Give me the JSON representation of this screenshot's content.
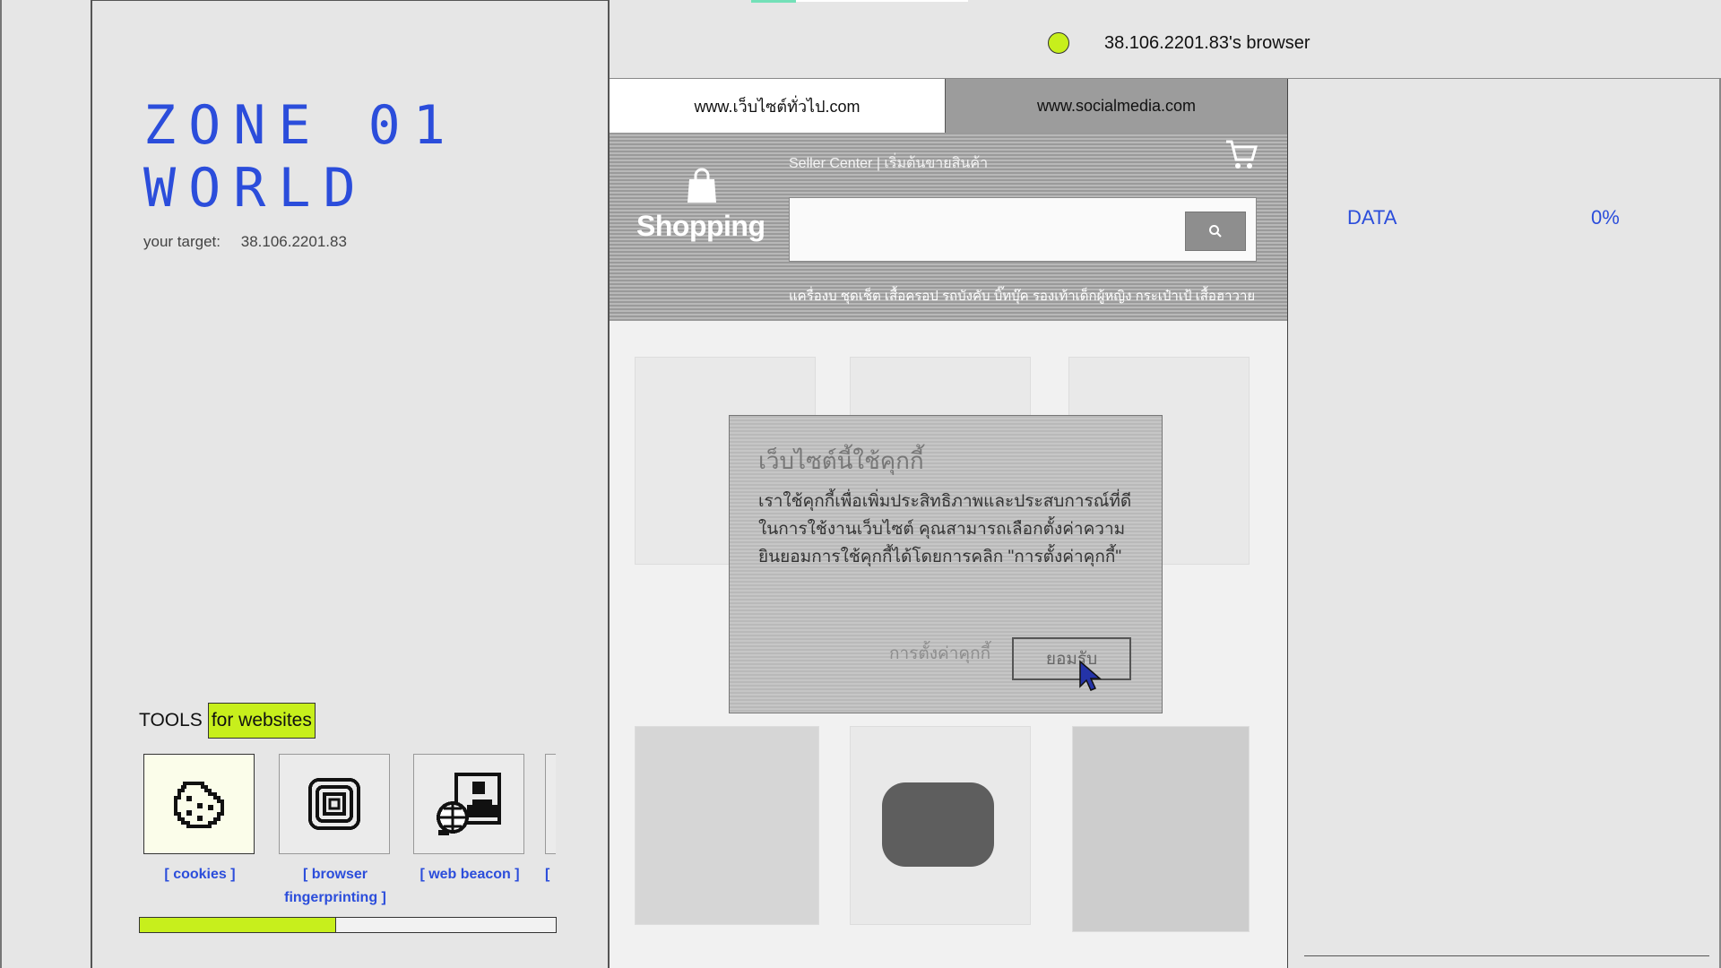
{
  "zone": {
    "title_line1": "ZONE 01",
    "title_line2": "WORLD"
  },
  "target": {
    "label": "your target:",
    "value": "38.106.2201.83"
  },
  "tools": {
    "label": "TOOLS",
    "pill": "for websites",
    "items": [
      {
        "label": "[ cookies ]",
        "icon": "cookie-icon",
        "active": true
      },
      {
        "label": "[ browser fingerprinting ]",
        "icon": "fingerprint-icon",
        "active": false
      },
      {
        "label": "[ web beacon ]",
        "icon": "web-beacon-icon",
        "active": false
      },
      {
        "label": "[",
        "icon": "",
        "active": false
      }
    ],
    "progress": 0.47
  },
  "browser": {
    "title": "38.106.2201.83's browser",
    "status_color": "#c7ef1c",
    "tabs": [
      {
        "label": "www.เว็บไซต์ทั่วไป.com",
        "active": true
      },
      {
        "label": "www.socialmedia.com",
        "active": false
      }
    ]
  },
  "site": {
    "seller_link": "Seller Center  |  เริ่มต้นขายสินค้า",
    "brand": "Shopping",
    "categories": "แครื่องบ ชุดเช็ต เสื้อครอป รถบังคับ บิ๊ทบุ๊ค รองเท้าเด็กผู้หญิง กระเป๋าเป้ เสื้อฮาวาย"
  },
  "cookie_modal": {
    "title": "เว็บไซต์นี้ใช้คุกกี้",
    "body": "เราใช้คุกกี้เพื่อเพิ่มประสิทธิภาพและประสบการณ์ที่ดีในการใช้งานเว็บไซต์ คุณสามารถเลือกตั้งค่าความยินยอมการใช้คุกกี้ได้โดยการคลิก \"การตั้งค่าคุกกี้\"",
    "settings_button": "การตั้งค่าคุกกี้",
    "accept_button": "ยอมรับ"
  },
  "data_panel": {
    "label": "DATA",
    "value": "0%"
  },
  "colors": {
    "accent": "#2b4ddb",
    "highlight": "#c7ef1c"
  }
}
